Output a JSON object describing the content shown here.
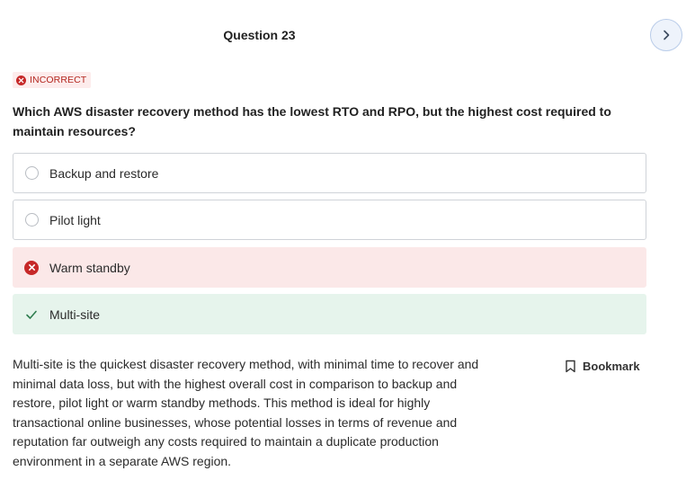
{
  "question": {
    "header": "Question 23",
    "status": "INCORRECT",
    "text": "Which AWS disaster recovery method has the lowest RTO and RPO, but the highest cost required to maintain resources?"
  },
  "options": [
    {
      "label": "Backup and restore",
      "state": "neutral"
    },
    {
      "label": "Pilot light",
      "state": "neutral"
    },
    {
      "label": "Warm standby",
      "state": "wrong"
    },
    {
      "label": "Multi-site",
      "state": "correct"
    }
  ],
  "explanation": "Multi-site is the quickest disaster recovery method, with minimal time to recover and minimal data loss, but with the highest overall cost in comparison to backup and restore, pilot light or warm standby methods. This method is ideal for highly transactional online businesses, whose potential losses in terms of revenue and reputation far outweigh any costs required to maintain a duplicate production environment in a separate AWS region.",
  "bookmark": {
    "label": "Bookmark",
    "icon": "bookmark-icon"
  },
  "navigation": {
    "next_icon": "chevron-right-icon"
  },
  "colors": {
    "incorrect": "#c62828",
    "wrong_bg": "#fbe8e8",
    "correct_bg": "#e6f4ec",
    "correct_check": "#2e7d4f",
    "accent": "#b9cce9"
  }
}
